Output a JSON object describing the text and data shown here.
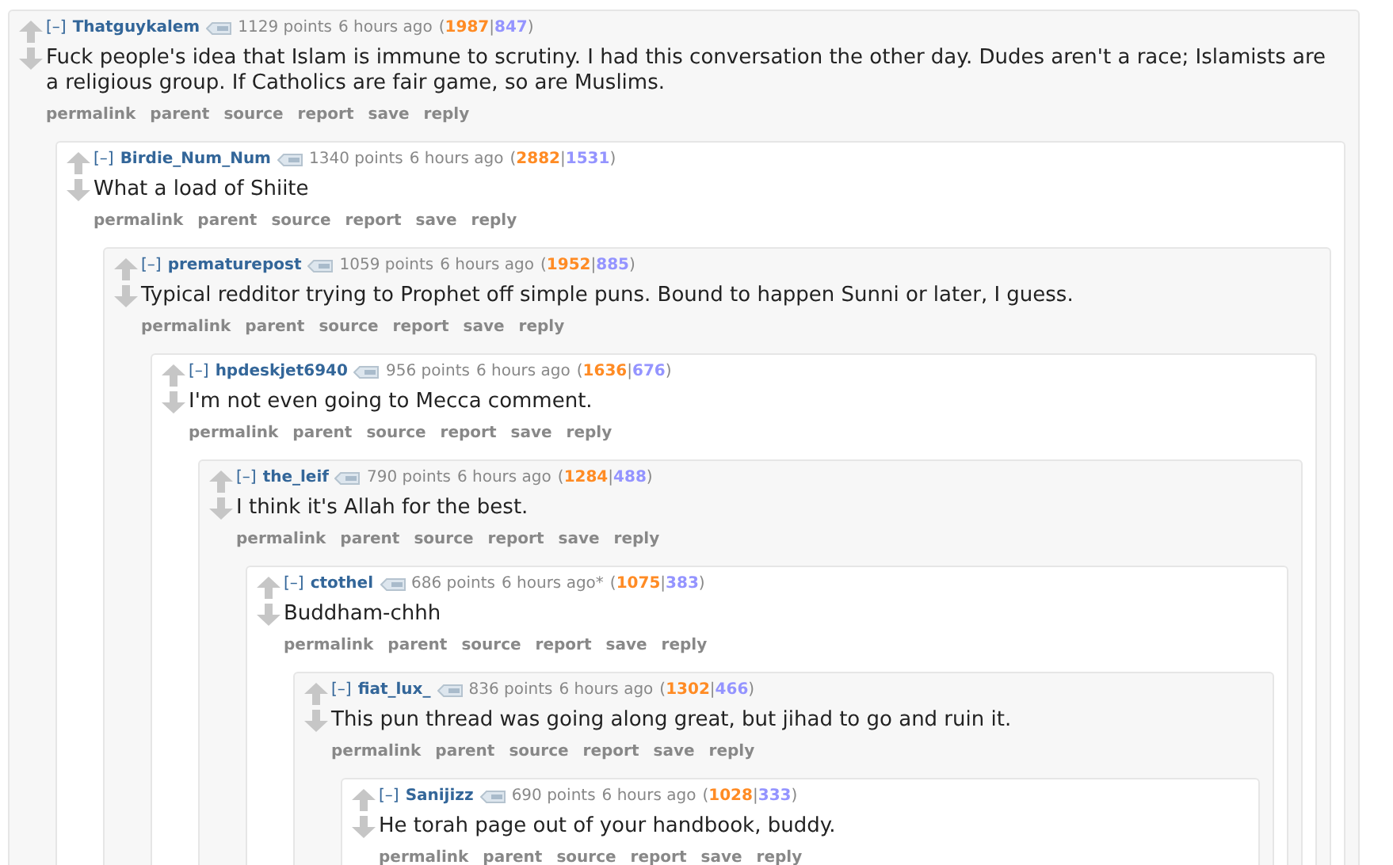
{
  "comments": [
    {
      "toggle": "[–]",
      "author": "Thatguykalem",
      "score": "1129 points",
      "time": "6 hours ago",
      "breakdown": [
        {
          "text": "(",
          "kind": "punct"
        },
        {
          "text": "1987",
          "kind": "up"
        },
        {
          "text": "|",
          "kind": "punct"
        },
        {
          "text": "847",
          "kind": "down"
        },
        {
          "text": ")",
          "kind": "punct"
        }
      ],
      "body": "Fuck people's idea that Islam is immune to scrutiny. I had this conversation the other day. Dudes aren't a race; Islamists are a religious group. If Catholics are fair game, so are Muslims.",
      "actions": [
        "permalink",
        "parent",
        "source",
        "report",
        "save",
        "reply"
      ],
      "children": [
        {
          "toggle": "[–]",
          "author": "Birdie_Num_Num",
          "score": "1340 points",
          "time": "6 hours ago",
          "breakdown": [
            {
              "text": "(",
              "kind": "punct"
            },
            {
              "text": "2882",
              "kind": "up"
            },
            {
              "text": "|",
              "kind": "punct"
            },
            {
              "text": "1531",
              "kind": "down"
            },
            {
              "text": ")",
              "kind": "punct"
            }
          ],
          "body": "What a load of Shiite",
          "actions": [
            "permalink",
            "parent",
            "source",
            "report",
            "save",
            "reply"
          ],
          "children": [
            {
              "toggle": "[–]",
              "author": "prematurepost",
              "score": "1059 points",
              "time": "6 hours ago",
              "breakdown": [
                {
                  "text": "(",
                  "kind": "punct"
                },
                {
                  "text": "1952",
                  "kind": "up"
                },
                {
                  "text": "|",
                  "kind": "punct"
                },
                {
                  "text": "885",
                  "kind": "down"
                },
                {
                  "text": ")",
                  "kind": "punct"
                }
              ],
              "body": "Typical redditor trying to Prophet off simple puns. Bound to happen Sunni or later, I guess.",
              "actions": [
                "permalink",
                "parent",
                "source",
                "report",
                "save",
                "reply"
              ],
              "children": [
                {
                  "toggle": "[–]",
                  "author": "hpdeskjet6940",
                  "score": "956 points",
                  "time": "6 hours ago",
                  "breakdown": [
                    {
                      "text": "(",
                      "kind": "punct"
                    },
                    {
                      "text": "1636",
                      "kind": "up"
                    },
                    {
                      "text": "|",
                      "kind": "punct"
                    },
                    {
                      "text": "676",
                      "kind": "down"
                    },
                    {
                      "text": ")",
                      "kind": "punct"
                    }
                  ],
                  "body": "I'm not even going to Mecca comment.",
                  "actions": [
                    "permalink",
                    "parent",
                    "source",
                    "report",
                    "save",
                    "reply"
                  ],
                  "children": [
                    {
                      "toggle": "[–]",
                      "author": "the_leif",
                      "score": "790 points",
                      "time": "6 hours ago",
                      "breakdown": [
                        {
                          "text": "(",
                          "kind": "punct"
                        },
                        {
                          "text": "1284",
                          "kind": "up"
                        },
                        {
                          "text": "|",
                          "kind": "punct"
                        },
                        {
                          "text": "488",
                          "kind": "down"
                        },
                        {
                          "text": ")",
                          "kind": "punct"
                        }
                      ],
                      "body": "I think it's Allah for the best.",
                      "actions": [
                        "permalink",
                        "parent",
                        "source",
                        "report",
                        "save",
                        "reply"
                      ],
                      "children": [
                        {
                          "toggle": "[–]",
                          "author": "ctothel",
                          "score": "686 points",
                          "time": "6 hours ago*",
                          "breakdown": [
                            {
                              "text": "(",
                              "kind": "punct"
                            },
                            {
                              "text": "1075",
                              "kind": "up"
                            },
                            {
                              "text": "|",
                              "kind": "punct"
                            },
                            {
                              "text": "383",
                              "kind": "down"
                            },
                            {
                              "text": ")",
                              "kind": "punct"
                            }
                          ],
                          "body": "Buddham-chhh",
                          "actions": [
                            "permalink",
                            "parent",
                            "source",
                            "report",
                            "save",
                            "reply"
                          ],
                          "children": [
                            {
                              "toggle": "[–]",
                              "author": "fiat_lux_",
                              "score": "836 points",
                              "time": "6 hours ago",
                              "breakdown": [
                                {
                                  "text": "(",
                                  "kind": "punct"
                                },
                                {
                                  "text": "1302",
                                  "kind": "up"
                                },
                                {
                                  "text": "|",
                                  "kind": "punct"
                                },
                                {
                                  "text": "466",
                                  "kind": "down"
                                },
                                {
                                  "text": ")",
                                  "kind": "punct"
                                }
                              ],
                              "body": "This pun thread was going along great, but jihad to go and ruin it.",
                              "actions": [
                                "permalink",
                                "parent",
                                "source",
                                "report",
                                "save",
                                "reply"
                              ],
                              "children": [
                                {
                                  "toggle": "[–]",
                                  "author": "Sanijizz",
                                  "score": "690 points",
                                  "time": "6 hours ago",
                                  "breakdown": [
                                    {
                                      "text": "(",
                                      "kind": "punct"
                                    },
                                    {
                                      "text": "1028",
                                      "kind": "up"
                                    },
                                    {
                                      "text": "|",
                                      "kind": "punct"
                                    },
                                    {
                                      "text": "333",
                                      "kind": "down"
                                    },
                                    {
                                      "text": ")",
                                      "kind": "punct"
                                    }
                                  ],
                                  "body": "He torah page out of your handbook, buddy.",
                                  "actions": [
                                    "permalink",
                                    "parent",
                                    "source",
                                    "report",
                                    "save",
                                    "reply"
                                  ]
                                }
                              ]
                            }
                          ]
                        }
                      ]
                    }
                  ]
                }
              ]
            }
          ]
        }
      ]
    }
  ]
}
